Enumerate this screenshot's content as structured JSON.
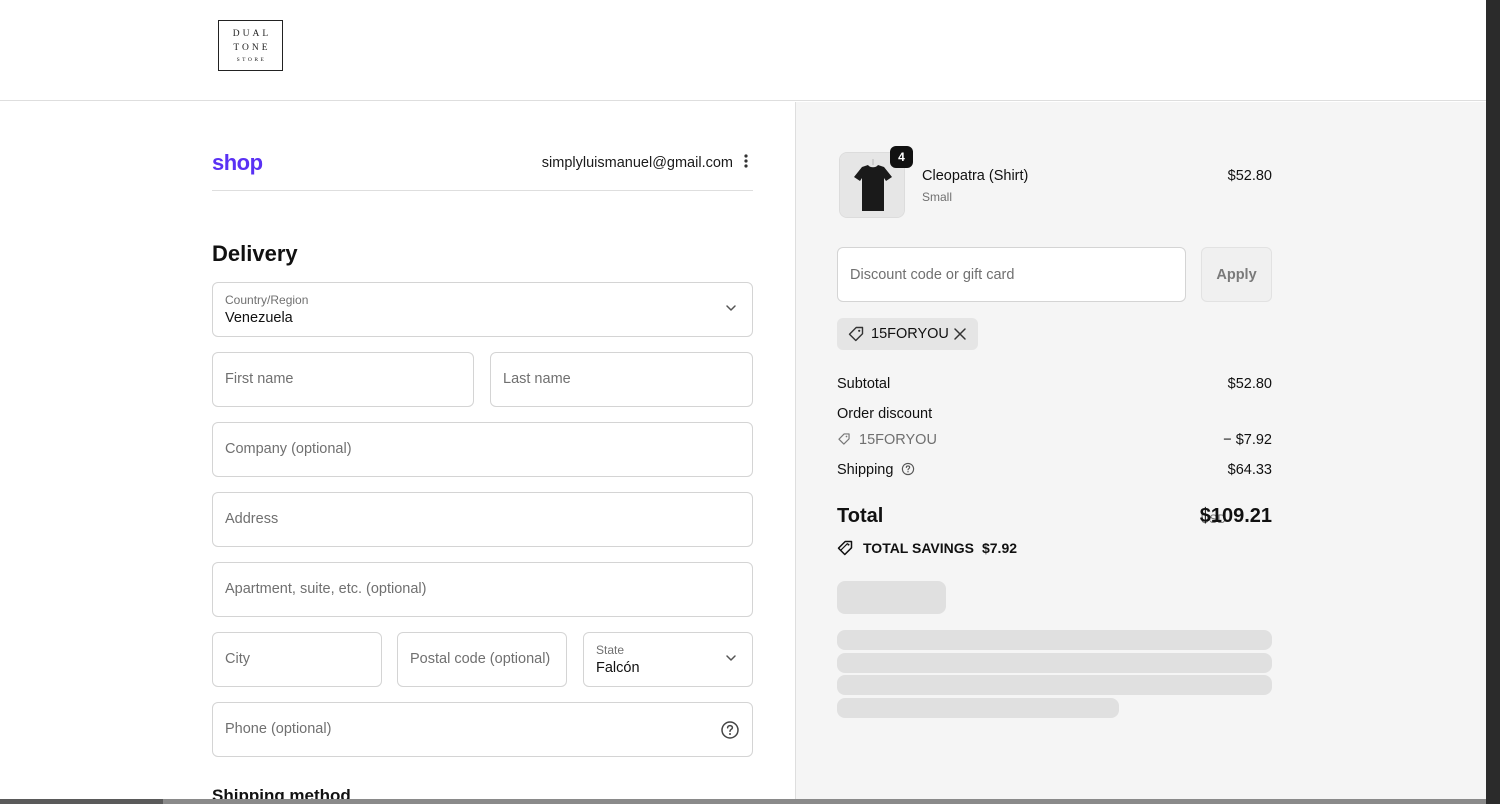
{
  "brand": {
    "logo_line1": "DUAL",
    "logo_line2": "TONE",
    "logo_line3": "STORE"
  },
  "shop_pay": {
    "logo_text": "shop",
    "account_email": "simplyluismanuel@gmail.com",
    "menu_icon": "kebab-icon"
  },
  "delivery": {
    "heading": "Delivery",
    "country": {
      "label": "Country/Region",
      "value": "Venezuela"
    },
    "first_name": {
      "placeholder": "First name"
    },
    "last_name": {
      "placeholder": "Last name"
    },
    "company": {
      "placeholder": "Company (optional)"
    },
    "address": {
      "placeholder": "Address"
    },
    "apartment": {
      "placeholder": "Apartment, suite, etc. (optional)"
    },
    "city": {
      "placeholder": "City"
    },
    "postal": {
      "placeholder": "Postal code (optional)"
    },
    "state": {
      "label": "State",
      "value": "Falcón"
    },
    "phone": {
      "placeholder": "Phone (optional)"
    }
  },
  "shipping_method": {
    "heading": "Shipping method"
  },
  "cart": {
    "items": [
      {
        "name": "Cleopatra (Shirt)",
        "variant": "Small",
        "price": "$52.80",
        "quantity": "4"
      }
    ],
    "discount": {
      "placeholder": "Discount code or gift card",
      "apply_label": "Apply",
      "applied_code": "15FORYOU"
    },
    "summary": {
      "subtotal_label": "Subtotal",
      "subtotal_value": "$52.80",
      "order_discount_label": "Order discount",
      "discount_code": "15FORYOU",
      "discount_value": "− $7.92",
      "shipping_label": "Shipping",
      "shipping_value": "$64.33",
      "total_label": "Total",
      "currency": "USD",
      "total_value": "$109.21",
      "savings_label": "TOTAL SAVINGS",
      "savings_value": "$7.92"
    }
  },
  "colors": {
    "shop_brand": "#5a31f4",
    "summary_bg": "#f5f5f5",
    "skeleton": "#e0e0e0"
  }
}
